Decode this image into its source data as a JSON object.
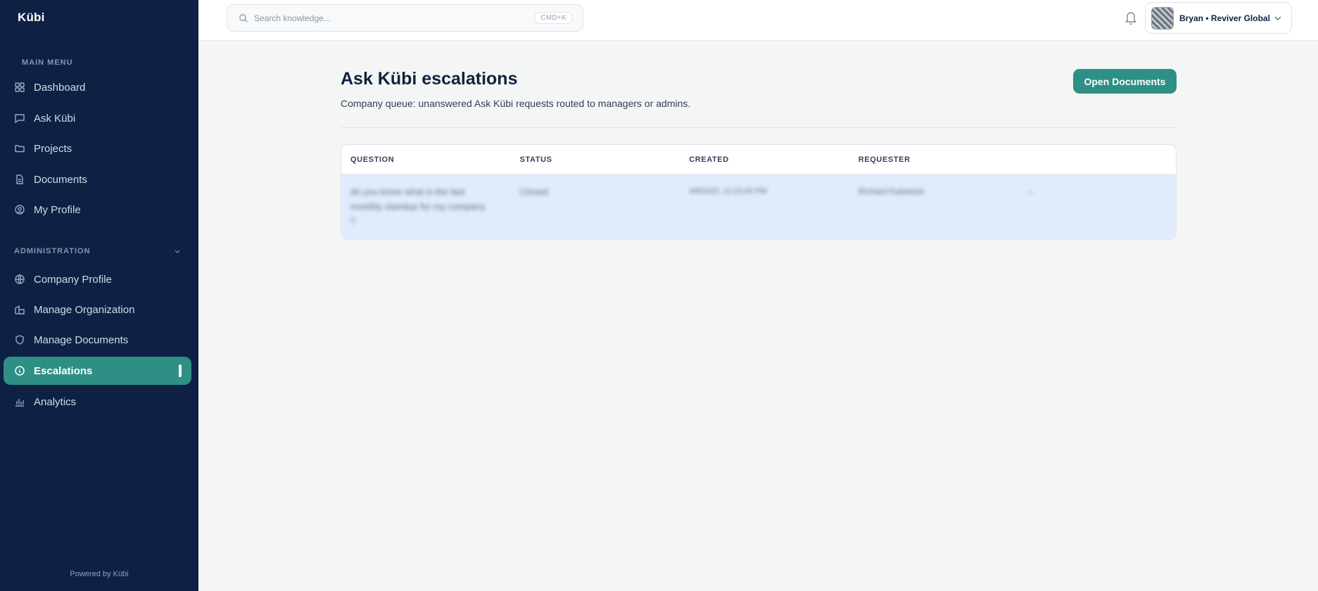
{
  "sidebar": {
    "logo": "Kübi",
    "main_menu_label": "MAIN MENU",
    "main_items": [
      {
        "label": "Dashboard",
        "icon": "grid-icon"
      },
      {
        "label": "Ask Kübi",
        "icon": "chat-icon"
      },
      {
        "label": "Projects",
        "icon": "folder-icon"
      },
      {
        "label": "Documents",
        "icon": "document-icon"
      },
      {
        "label": "My Profile",
        "icon": "user-circle-icon"
      }
    ],
    "admin_label": "ADMINISTRATION",
    "admin_items": [
      {
        "label": "Company Profile",
        "icon": "globe-icon"
      },
      {
        "label": "Manage Organization",
        "icon": "building-icon"
      },
      {
        "label": "Manage Documents",
        "icon": "shield-icon"
      },
      {
        "label": "Escalations",
        "icon": "info-icon",
        "active": true
      },
      {
        "label": "Analytics",
        "icon": "bar-chart-icon"
      }
    ],
    "powered_by": "Powered by Kübi"
  },
  "topbar": {
    "search_placeholder": "Search knowledge...",
    "search_shortcut": "CMD+K",
    "user_label": "Bryan • Reviver Global"
  },
  "page": {
    "title": "Ask Kübi escalations",
    "subtitle": "Company queue: unanswered Ask Kübi requests routed to managers or admins.",
    "open_documents_label": "Open Documents"
  },
  "table": {
    "columns": [
      "QUESTION",
      "STATUS",
      "CREATED",
      "REQUESTER",
      ""
    ],
    "rows": [
      {
        "question": "do you know what is the last monthly standup for my company ?",
        "status": "Closed",
        "created": "4/8/2025, 11:23:49 PM",
        "requester": "Richard Kalatsiuk",
        "extra": "–"
      }
    ]
  },
  "colors": {
    "sidebar_bg": "#0e2145",
    "accent": "#2e8f85",
    "row_highlight": "#e2ebfb"
  }
}
